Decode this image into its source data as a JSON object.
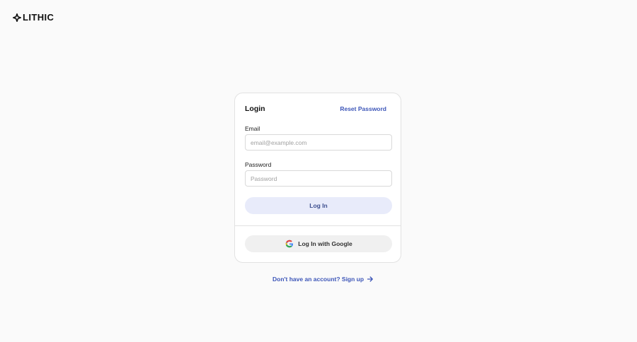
{
  "brand": {
    "name": "LITHIC",
    "logo_icon": "lithic-logo-icon"
  },
  "login": {
    "title": "Login",
    "reset_label": "Reset Password",
    "email": {
      "label": "Email",
      "placeholder": "email@example.com",
      "value": ""
    },
    "password": {
      "label": "Password",
      "placeholder": "Password",
      "value": ""
    },
    "login_button": "Log In",
    "google_button": "Log In with Google",
    "google_icon": "google-icon"
  },
  "signup": {
    "label": "Don't have an account? Sign up",
    "icon": "arrow-right-icon"
  },
  "colors": {
    "link": "#3d56b8",
    "login_button_bg": "#e8ebfa",
    "google_button_bg": "#f0f0f0",
    "page_bg": "#fafafa"
  }
}
